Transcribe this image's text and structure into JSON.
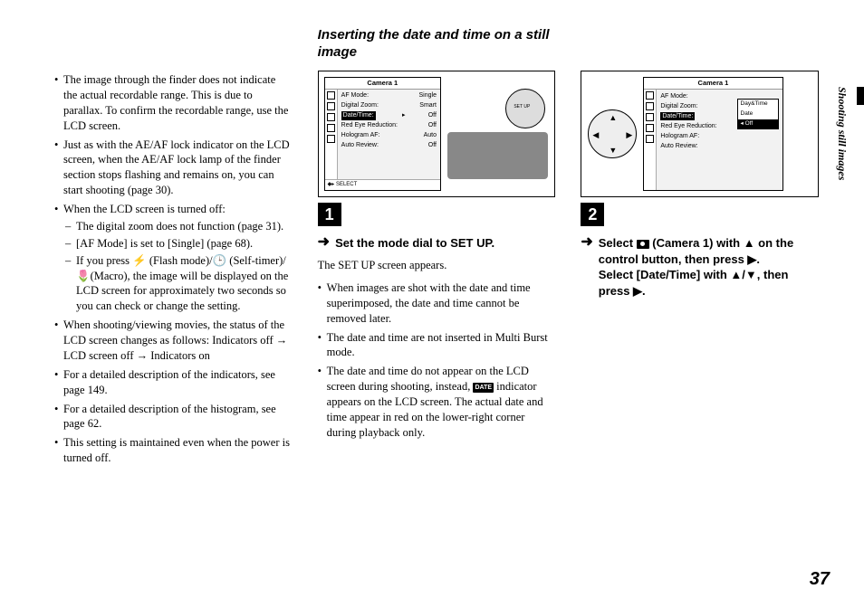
{
  "side_label": "Shooting still images",
  "page_number": "37",
  "col1": {
    "bullets": [
      "The image through the finder does not indicate the actual recordable range. This is due to parallax. To confirm the recordable range, use the LCD screen.",
      "Just as with the AE/AF lock indicator on the LCD screen, when the AE/AF lock lamp of the finder section stops flashing and remains on, you can start shooting (page 30).",
      "When the LCD screen is turned off:"
    ],
    "sub_bullets": [
      "The digital zoom does not function (page 31).",
      "[AF Mode] is set to [Single] (page 68).",
      "If you press ⚡ (Flash mode)/🕒 (Self-timer)/ 🌷(Macro), the image will be displayed on the LCD screen for approximately two seconds so you can check or change the setting."
    ],
    "bullets2": [
      "When shooting/viewing movies, the status of the LCD screen changes as follows: Indicators off → LCD screen off → Indicators on",
      "For a detailed description of the indicators, see page 149.",
      "For a detailed description of the histogram, see page 62.",
      "This setting is maintained even when the power is turned off."
    ]
  },
  "section_title": "Inserting the date and time on a still image",
  "menu1": {
    "title": "Camera 1",
    "rows": [
      {
        "k": "AF Mode:",
        "v": "Single"
      },
      {
        "k": "Digital Zoom:",
        "v": "Smart"
      },
      {
        "k": "Date/Time:",
        "v": "Off",
        "hl": true
      },
      {
        "k": "Red Eye Reduction:",
        "v": "Off"
      },
      {
        "k": "Hologram AF:",
        "v": "Auto"
      },
      {
        "k": "Auto Review:",
        "v": "Off"
      }
    ],
    "foot": "SELECT"
  },
  "menu2": {
    "title": "Camera 1",
    "rows": [
      {
        "k": "AF Mode:",
        "v": ""
      },
      {
        "k": "Digital Zoom:",
        "v": ""
      },
      {
        "k": "Date/Time:",
        "v": "",
        "hl": true
      },
      {
        "k": "Red Eye Reduction:",
        "v": ""
      },
      {
        "k": "Hologram AF:",
        "v": ""
      },
      {
        "k": "Auto Review:",
        "v": ""
      }
    ],
    "submenu": [
      "Day&Time",
      "Date",
      "Off"
    ],
    "submenu_sel": 2
  },
  "step1": {
    "number": "1",
    "heading": "Set the mode dial to SET UP.",
    "body": "The SET UP screen appears.",
    "bullets": [
      "When images are shot with the date and time superimposed, the date and time cannot be removed later.",
      "The date and time are not inserted in Multi Burst mode.",
      "The date and time do not appear on the LCD screen during shooting, instead, DATE indicator appears on the LCD screen. The actual date and time appear in red on the lower-right corner during playback only."
    ]
  },
  "step2": {
    "number": "2",
    "heading_p1": "Select ",
    "heading_p2": " (Camera 1) with ▲ on the control button, then press ▶.",
    "heading_p3": "Select [Date/Time] with ▲/▼, then press ▶."
  }
}
